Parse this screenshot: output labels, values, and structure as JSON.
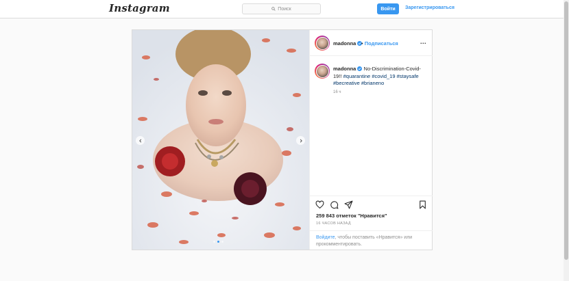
{
  "app": {
    "logo_text": "Instagram",
    "colors": {
      "accent": "#3897f0",
      "border": "#dbdbdb",
      "background": "#fafafa"
    }
  },
  "header": {
    "search": {
      "placeholder": "Поиск",
      "icon": "search-icon"
    },
    "login_button": "Войти",
    "signup_link": "Зарегистрироваться"
  },
  "post": {
    "username": "madonna",
    "verified": true,
    "follow_separator": "•",
    "follow_label": "Подписаться",
    "more_icon": "more-options-icon",
    "more_label": "...",
    "caption": {
      "username": "madonna",
      "text": "No-Discrimination-Covid-19!!",
      "hashtags": [
        "#quarantine",
        "#covid_19",
        "#staysafe",
        "#becreative",
        "#brianeno"
      ]
    },
    "caption_time": "16 ч",
    "carousel": {
      "total": 3,
      "current": 2
    },
    "actions": [
      "heart-icon",
      "comment-icon",
      "share-icon",
      "bookmark-icon"
    ],
    "likes_text": "259 843 отметок \"Нравится\"",
    "time_ago": "16 ЧАСОВ НАЗАД",
    "login_prompt": {
      "link": "Войдите",
      "text": ", чтобы поставить «Нравится» или прокомментировать."
    }
  }
}
